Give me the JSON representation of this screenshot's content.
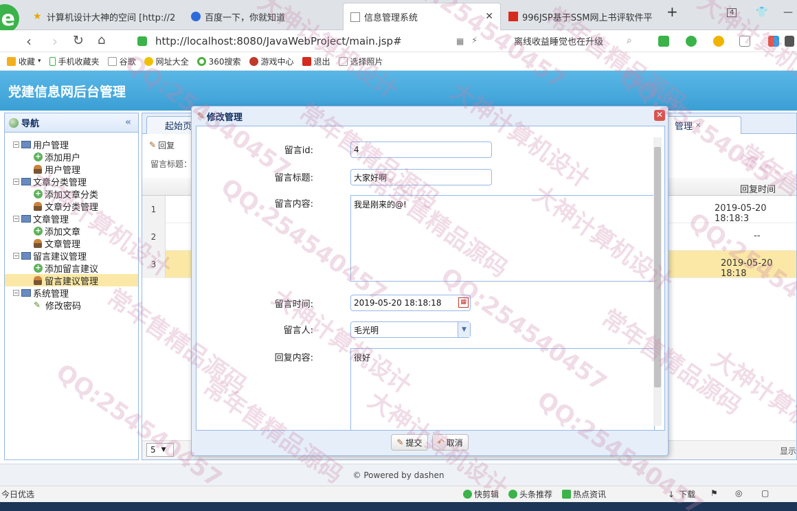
{
  "browser": {
    "tabs": [
      {
        "label": "计算机设计大神的空间 [http://2",
        "active": false
      },
      {
        "label": "百度一下，你就知道",
        "active": false
      },
      {
        "label": "信息管理系统",
        "active": true
      },
      {
        "label": "996JSP基于SSM网上书评软件平",
        "active": false
      }
    ],
    "new_tab": "+",
    "tab_count": "4",
    "url": "http://localhost:8080/JavaWebProject/main.jsp#",
    "promo_text": "离线收益睡觉也在升级",
    "bookmarks": [
      "收藏",
      "手机收藏夹",
      "谷歌",
      "网址大全",
      "360搜索",
      "游戏中心",
      "退出",
      "选择照片"
    ]
  },
  "app": {
    "title": "党建信息网后台管理",
    "nav": {
      "title": "导航",
      "tree": [
        {
          "label": "用户管理",
          "level": 1,
          "icon": "computer-icon"
        },
        {
          "label": "添加用户",
          "level": 2,
          "icon": "add-icon"
        },
        {
          "label": "用户管理",
          "level": 2,
          "icon": "user-icon"
        },
        {
          "label": "文章分类管理",
          "level": 1,
          "icon": "computer-icon"
        },
        {
          "label": "添加文章分类",
          "level": 2,
          "icon": "add-icon"
        },
        {
          "label": "文章分类管理",
          "level": 2,
          "icon": "user-icon"
        },
        {
          "label": "文章管理",
          "level": 1,
          "icon": "computer-icon"
        },
        {
          "label": "添加文章",
          "level": 2,
          "icon": "add-icon"
        },
        {
          "label": "文章管理",
          "level": 2,
          "icon": "user-icon"
        },
        {
          "label": "留言建议管理",
          "level": 1,
          "icon": "computer-icon"
        },
        {
          "label": "添加留言建议",
          "level": 2,
          "icon": "add-icon"
        },
        {
          "label": "留言建议管理",
          "level": 2,
          "icon": "user-icon",
          "selected": true
        },
        {
          "label": "系统管理",
          "level": 1,
          "icon": "computer-icon"
        },
        {
          "label": "修改密码",
          "level": 2,
          "icon": "pencil-icon"
        }
      ]
    },
    "main": {
      "tabs": [
        "起始页",
        "管理"
      ],
      "toolbar": {
        "reply_label": "回复"
      },
      "search_label": "留言标题：",
      "grid": {
        "last_column_header": "回复时间",
        "rows": [
          {
            "num": "1",
            "reply_time": "2019-05-20 18:18:3"
          },
          {
            "num": "2",
            "reply_time": "--"
          },
          {
            "num": "3",
            "reply_time": "2019-05-20 18:18"
          }
        ]
      },
      "page_size": "5",
      "pager_right": "显示"
    },
    "footer": "© Powered by dashen"
  },
  "dialog": {
    "title": "修改管理",
    "fields": {
      "id": {
        "label": "留言id:",
        "value": "4"
      },
      "title": {
        "label": "留言标题:",
        "value": "大家好啊"
      },
      "content": {
        "label": "留言内容:",
        "value": "我是刚来的@!"
      },
      "time": {
        "label": "留言时间:",
        "value": "2019-05-20 18:18:18"
      },
      "user": {
        "label": "留言人:",
        "value": "毛光明"
      },
      "reply": {
        "label": "回复内容:",
        "value": "很好"
      }
    },
    "submit_label": "提交",
    "cancel_label": "取消"
  },
  "statusbar": {
    "left": "今日优选",
    "items": [
      "快剪辑",
      "头条推荐",
      "热点资讯",
      "下载"
    ]
  },
  "watermark": [
    "大神计算机设计",
    "QQ:254540457",
    "常年售精品源码"
  ]
}
